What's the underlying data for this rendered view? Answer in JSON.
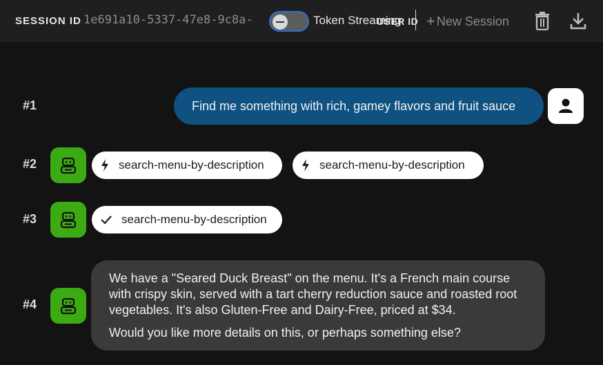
{
  "header": {
    "session_label": "SESSION ID",
    "session_id": "1e691a10-5337-47e8-9c8a-",
    "token_streaming_label": "Token Streaming",
    "token_streaming_enabled": false,
    "user_label": "USER ID",
    "new_session_label": "New Session",
    "icons": [
      "plus-icon",
      "trash-icon",
      "download-icon"
    ]
  },
  "colors": {
    "topbar": "#1f1f1f",
    "background": "#131313",
    "user_bubble": "#0f5282",
    "bot_avatar": "#3caa12",
    "bot_bubble": "#3a3a3a",
    "toggle_border": "#2f6fd8"
  },
  "messages": [
    {
      "number": "#1",
      "role": "user",
      "text": "Find me something with rich, gamey flavors and fruit sauce",
      "avatar_icon": "person-icon"
    },
    {
      "number": "#2",
      "role": "bot",
      "avatar_icon": "robot-icon",
      "chips": [
        {
          "icon": "lightning-icon",
          "label": "search-menu-by-description"
        },
        {
          "icon": "lightning-icon",
          "label": "search-menu-by-description"
        }
      ]
    },
    {
      "number": "#3",
      "role": "bot",
      "avatar_icon": "robot-icon",
      "chips": [
        {
          "icon": "checkmark-icon",
          "label": "search-menu-by-description"
        }
      ]
    },
    {
      "number": "#4",
      "role": "bot",
      "avatar_icon": "robot-icon",
      "paragraphs": [
        "We have a \"Seared Duck Breast\" on the menu. It's a French main course with crispy skin, served with a tart cherry reduction sauce and roasted root vegetables. It's also Gluten-Free and Dairy-Free, priced at $34.",
        "Would you like more details on this, or perhaps something else?"
      ]
    }
  ]
}
